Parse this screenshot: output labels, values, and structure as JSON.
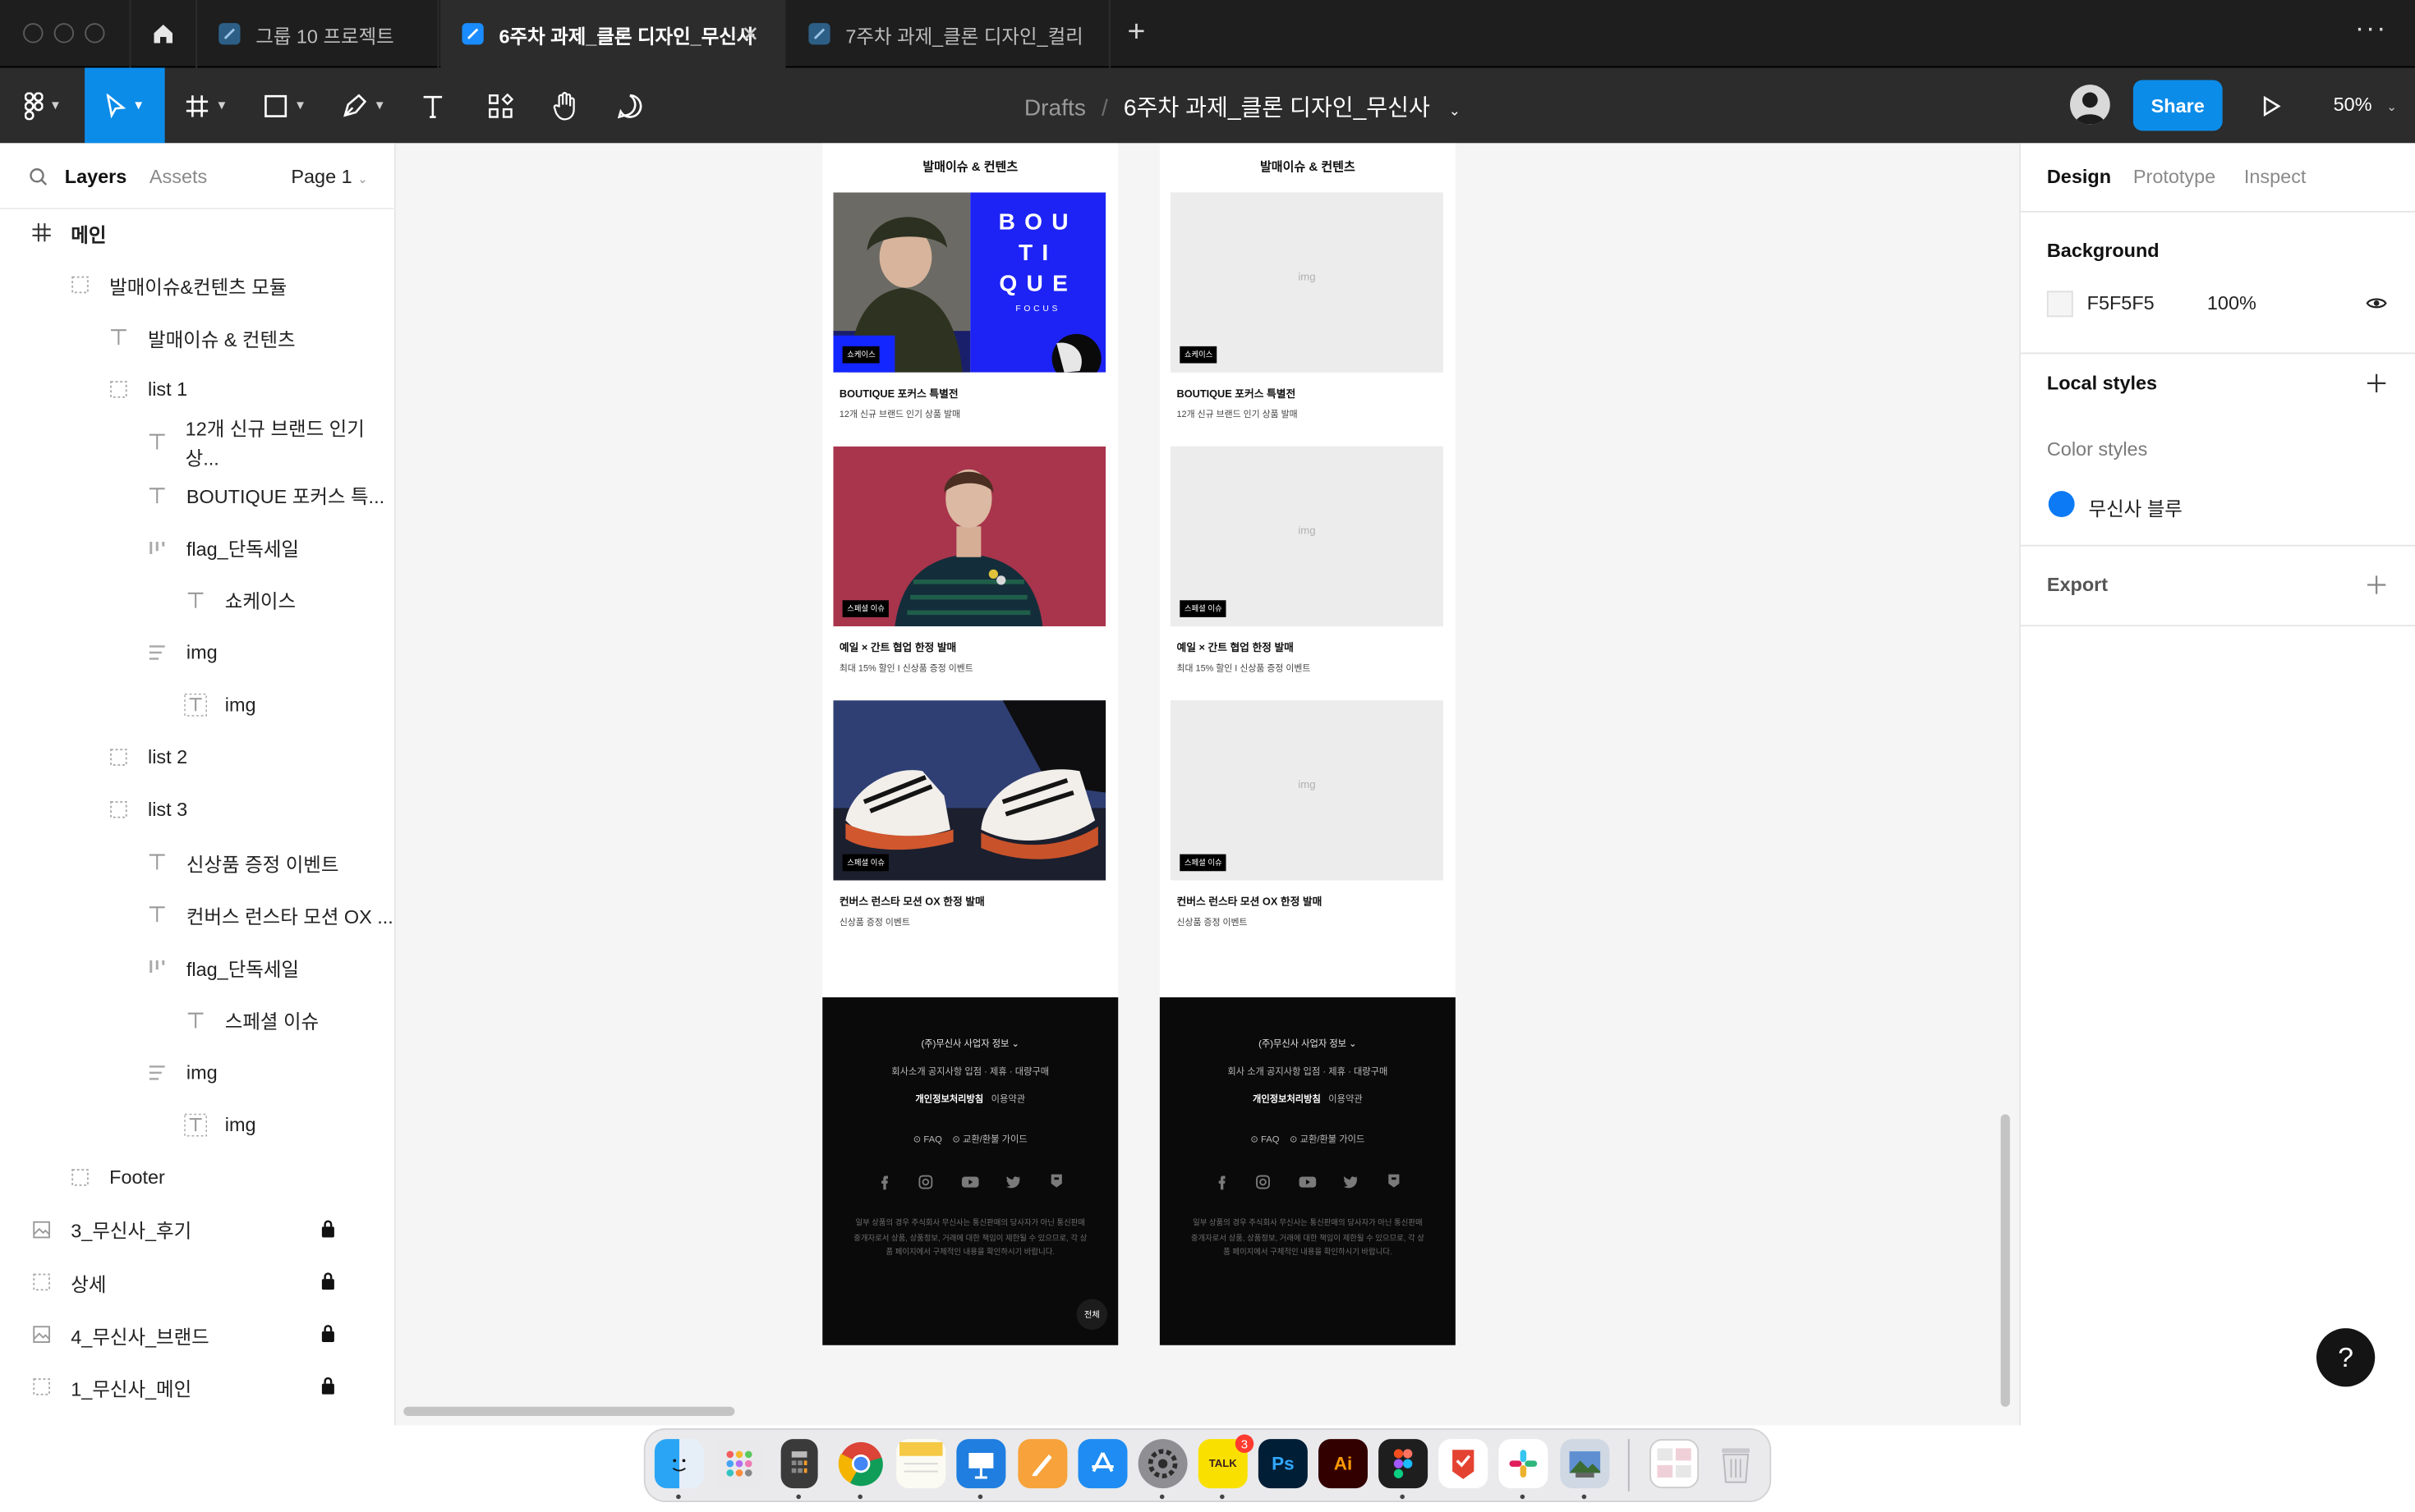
{
  "window": {
    "tabs": [
      {
        "label": "그룹 10 프로젝트",
        "active": false
      },
      {
        "label": "6주차 과제_클론 디자인_무신사",
        "active": true
      },
      {
        "label": "7주차 과제_클론 디자인_컬리",
        "active": false
      }
    ],
    "new_tab_glyph": "+",
    "more_glyph": "···"
  },
  "toolbar": {
    "breadcrumb_root": "Drafts",
    "breadcrumb_sep": "/",
    "file_name": "6주차 과제_클론 디자인_무신사",
    "share_label": "Share",
    "zoom": "50%",
    "accent": "#0c8ce9"
  },
  "layers_panel": {
    "tab_layers": "Layers",
    "tab_assets": "Assets",
    "page_label": "Page 1",
    "items": [
      {
        "label": "메인",
        "icon": "frame-hash-icon",
        "indent": 0,
        "locked": false
      },
      {
        "label": "발매이슈&컨텐츠 모듈",
        "icon": "dashed-frame-icon",
        "indent": 1,
        "locked": false
      },
      {
        "label": "발매이슈 & 컨텐츠",
        "icon": "text-icon",
        "indent": 2,
        "locked": false
      },
      {
        "label": "list 1",
        "icon": "dashed-frame-icon",
        "indent": 2,
        "locked": false
      },
      {
        "label": "12개 신규 브랜드 인기 상...",
        "icon": "text-icon",
        "indent": 3,
        "locked": false
      },
      {
        "label": "BOUTIQUE 포커스 특...",
        "icon": "text-icon",
        "indent": 3,
        "locked": false
      },
      {
        "label": "flag_단독세일",
        "icon": "autolayout-icon",
        "indent": 3,
        "locked": false
      },
      {
        "label": "쇼케이스",
        "icon": "text-icon",
        "indent": 4,
        "locked": false
      },
      {
        "label": "img",
        "icon": "autolayout-lines-icon",
        "indent": 3,
        "locked": false
      },
      {
        "label": "img",
        "icon": "text-box-icon",
        "indent": 4,
        "locked": false
      },
      {
        "label": "list 2",
        "icon": "dashed-frame-icon",
        "indent": 2,
        "locked": false
      },
      {
        "label": "list 3",
        "icon": "dashed-frame-icon",
        "indent": 2,
        "locked": false
      },
      {
        "label": "신상품 증정 이벤트",
        "icon": "text-icon",
        "indent": 3,
        "locked": false
      },
      {
        "label": "컨버스 런스타 모션 OX ...",
        "icon": "text-icon",
        "indent": 3,
        "locked": false
      },
      {
        "label": "flag_단독세일",
        "icon": "autolayout-icon",
        "indent": 3,
        "locked": false
      },
      {
        "label": "스페셜 이슈",
        "icon": "text-icon",
        "indent": 4,
        "locked": false
      },
      {
        "label": "img",
        "icon": "autolayout-lines-icon",
        "indent": 3,
        "locked": false
      },
      {
        "label": "img",
        "icon": "text-box-icon",
        "indent": 4,
        "locked": false
      },
      {
        "label": "Footer",
        "icon": "dashed-frame-icon",
        "indent": 1,
        "locked": false
      },
      {
        "label": "3_무신사_후기",
        "icon": "image-frame-icon",
        "indent": 0,
        "locked": true
      },
      {
        "label": "상세",
        "icon": "dashed-frame-icon",
        "indent": 0,
        "locked": true
      },
      {
        "label": "4_무신사_브랜드",
        "icon": "image-frame-icon",
        "indent": 0,
        "locked": true
      },
      {
        "label": "1_무신사_메인",
        "icon": "dashed-frame-icon",
        "indent": 0,
        "locked": true
      }
    ]
  },
  "canvas": {
    "section_title": "발매이슈 & 컨텐츠",
    "placeholder_label": "img",
    "boutique_letters": [
      "BOU",
      "TI",
      "QUE"
    ],
    "boutique_sub": "FOCUS",
    "cards": [
      {
        "flag": "쇼케이스",
        "title": "BOUTIQUE 포커스 특별전",
        "subtitle": "12개 신규 브랜드 인기 상품 발매"
      },
      {
        "flag": "스페셜 이슈",
        "title": "예일 × 간트 협업 한정 발매",
        "subtitle": "최대 15% 할인 I 신상품 증정 이벤트"
      },
      {
        "flag": "스페셜 이슈",
        "title": "컨버스 런스타 모션 OX 한정 발매",
        "subtitle": "신상품 증정 이벤트"
      }
    ],
    "footer_left": {
      "company": "(주)무신사 사업자 정보",
      "links": "회사소개    공지사항    입점 · 제휴 · 대량구매",
      "policy_bold": "개인정보처리방침",
      "policy": "이용약관",
      "faq": "FAQ",
      "guide": "교환/환불 가이드",
      "disclaimer": "일부 상품의 경우 주식회사 무신사는 통신판매의 당사자가 아닌 통신판매중개자로서 상품, 상품정보, 거래에 대한 책임이 제한될 수 있으므로, 각 상품 페이지에서 구체적인 내용을 확인하시기 바랍니다.",
      "fab": "전체"
    },
    "footer_right": {
      "company": "(주)무신사 사업자 정보",
      "links": "회사 소개    공지사항    입점 · 제휴 · 대량구매",
      "policy_bold": "개인정보처리방침",
      "policy": "이용약관",
      "faq": "FAQ",
      "guide": "교환/환불 가이드",
      "disclaimer": "일부 상품의 경우 주식회사 무신사는 통신판매의 당사자가 아닌 통신판매중개자로서 상품, 상품정보, 거래에 대한 책임이 제한될 수 있으므로, 각 상품 페이지에서 구체적인 내용을 확인하시기 바랍니다."
    }
  },
  "design_panel": {
    "tab_design": "Design",
    "tab_prototype": "Prototype",
    "tab_inspect": "Inspect",
    "background_label": "Background",
    "background_hex": "F5F5F5",
    "background_opacity": "100%",
    "local_styles_label": "Local styles",
    "color_styles_label": "Color styles",
    "color_style_name": "무신사 블루",
    "color_style_value": "#0c7af5",
    "export_label": "Export",
    "help_glyph": "?"
  },
  "dock": {
    "apps": [
      "finder",
      "launchpad",
      "calculator",
      "chrome",
      "notes",
      "keynote",
      "pages",
      "app-store",
      "system-settings",
      "kakaotalk",
      "photoshop",
      "illustrator",
      "figma",
      "todoist",
      "slack",
      "preview",
      "screenshots",
      "trash"
    ],
    "talk_label": "TALK",
    "ps_label": "Ps",
    "ai_label": "Ai",
    "badge": "3"
  }
}
